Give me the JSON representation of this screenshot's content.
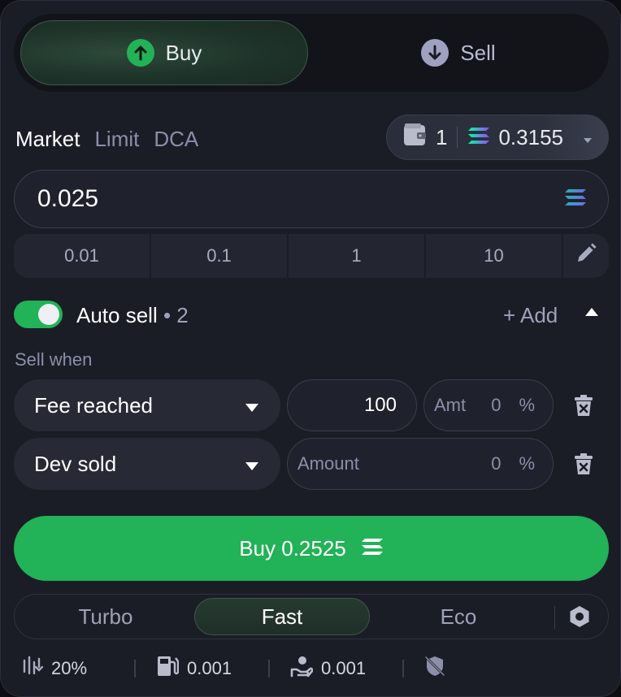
{
  "side_toggle": {
    "buy_label": "Buy",
    "sell_label": "Sell",
    "active": "buy"
  },
  "order_types": {
    "market": "Market",
    "limit": "Limit",
    "dca": "DCA",
    "active": "Market"
  },
  "wallet": {
    "count": "1",
    "balance": "0.3155",
    "icon": "wallet-icon",
    "token_icon": "solana-icon"
  },
  "amount_input": {
    "value": "0.025"
  },
  "presets": [
    "0.01",
    "0.1",
    "1",
    "10"
  ],
  "auto_sell": {
    "label": "Auto sell",
    "count": "• 2",
    "enabled": true,
    "add_label": "+ Add"
  },
  "sell_when_label": "Sell when",
  "conditions": [
    {
      "type": "Fee reached",
      "value": "100",
      "amt_label": "Amt",
      "amt_value": "0",
      "unit": "%"
    },
    {
      "type": "Dev sold",
      "amount_placeholder": "Amount",
      "amt_value": "0",
      "unit": "%"
    }
  ],
  "buy_button": {
    "label": "Buy 0.2525"
  },
  "speed": {
    "tabs": [
      "Turbo",
      "Fast",
      "Eco"
    ],
    "active": "Fast"
  },
  "stats": {
    "slippage": "20%",
    "gas_fee": "0.001",
    "priority_fee": "0.001"
  },
  "colors": {
    "accent": "#22b257",
    "panel": "#1a1d26",
    "muted": "#8b8fa8"
  }
}
